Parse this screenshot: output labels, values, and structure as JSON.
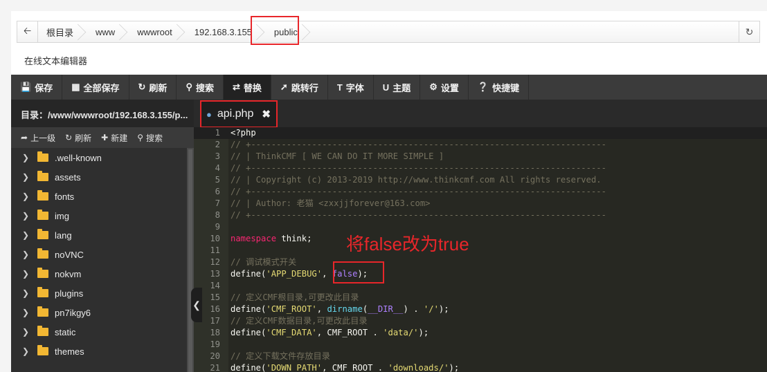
{
  "breadcrumb": {
    "items": [
      "根目录",
      "www",
      "wwwroot",
      "192.168.3.155",
      "public"
    ]
  },
  "editor_title": "在线文本编辑器",
  "toolbar": {
    "buttons": [
      {
        "label": "保存",
        "icon": "save-icon"
      },
      {
        "label": "全部保存",
        "icon": "save-all-icon"
      },
      {
        "label": "刷新",
        "icon": "refresh-icon"
      },
      {
        "label": "搜索",
        "icon": "search-icon"
      },
      {
        "label": "替换",
        "icon": "replace-icon"
      },
      {
        "label": "跳转行",
        "icon": "pin-icon"
      },
      {
        "label": "字体",
        "icon": "text-icon"
      },
      {
        "label": "主题",
        "icon": "theme-icon"
      },
      {
        "label": "设置",
        "icon": "gear-icon"
      },
      {
        "label": "快捷键",
        "icon": "help-icon"
      }
    ]
  },
  "sidebar": {
    "directory": "目录：/www/wwwroot/192.168.3.155/p...",
    "tools": [
      "上一级",
      "刷新",
      "新建",
      "搜索"
    ],
    "folders": [
      ".well-known",
      "assets",
      "fonts",
      "img",
      "lang",
      "noVNC",
      "nokvm",
      "plugins",
      "pn7ikgy6",
      "static",
      "themes"
    ]
  },
  "tab": {
    "filename": "api.php"
  },
  "code_lines": [
    {
      "n": "1",
      "text": "<?php"
    },
    {
      "n": "2",
      "text": "// +----------------------------------------------------------------------"
    },
    {
      "n": "3",
      "text": "// | ThinkCMF [ WE CAN DO IT MORE SIMPLE ]"
    },
    {
      "n": "4",
      "text": "// +----------------------------------------------------------------------"
    },
    {
      "n": "5",
      "text": "// | Copyright (c) 2013-2019 http://www.thinkcmf.com All rights reserved."
    },
    {
      "n": "6",
      "text": "// +----------------------------------------------------------------------"
    },
    {
      "n": "7",
      "text": "// | Author: 老猫 <zxxjjforever@163.com>"
    },
    {
      "n": "8",
      "text": "// +----------------------------------------------------------------------"
    },
    {
      "n": "9",
      "text": ""
    },
    {
      "n": "10",
      "text": "namespace think;"
    },
    {
      "n": "11",
      "text": ""
    },
    {
      "n": "12",
      "text": "// 调试模式开关"
    },
    {
      "n": "13",
      "text": "define('APP_DEBUG', false);"
    },
    {
      "n": "14",
      "text": ""
    },
    {
      "n": "15",
      "text": "// 定义CMF根目录,可更改此目录"
    },
    {
      "n": "16",
      "text": "define('CMF_ROOT', dirname(__DIR__) . '/');"
    },
    {
      "n": "17",
      "text": "// 定义CMF数据目录,可更改此目录"
    },
    {
      "n": "18",
      "text": "define('CMF_DATA', CMF_ROOT . 'data/');"
    },
    {
      "n": "19",
      "text": ""
    },
    {
      "n": "20",
      "text": "// 定义下载文件存放目录"
    },
    {
      "n": "21",
      "text": "define('DOWN_PATH', CMF_ROOT . 'downloads/');"
    }
  ],
  "annotation": "将false改为true"
}
